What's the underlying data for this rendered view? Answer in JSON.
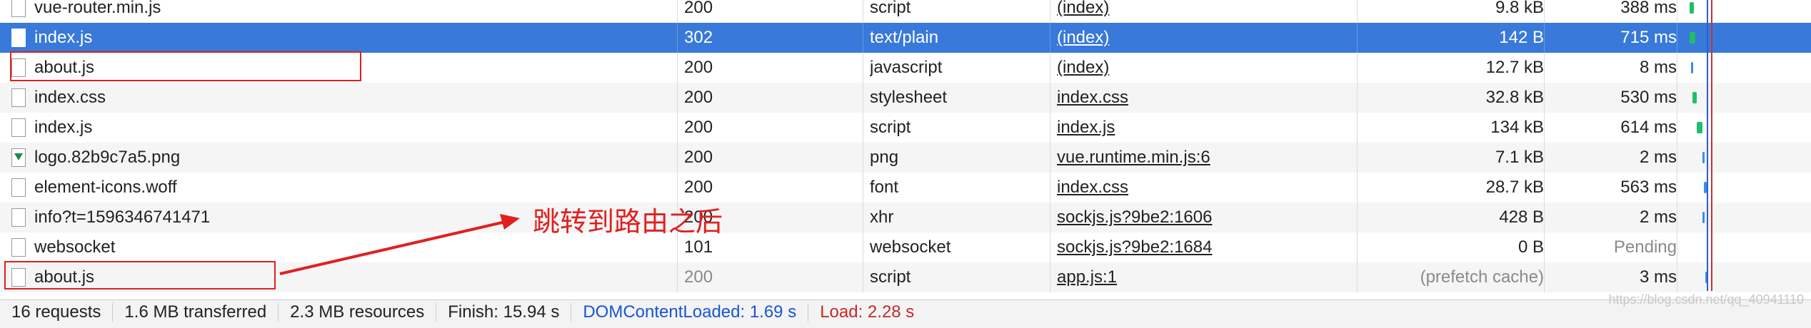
{
  "rows": [
    {
      "name": "vue-router.min.js",
      "status": "200",
      "type": "script",
      "initiator": "(index)",
      "size": "9.8 kB",
      "time": "388 ms",
      "icon": "file-icon",
      "size_dim": false,
      "status_dim": false
    },
    {
      "name": "index.js",
      "status": "302",
      "type": "text/plain",
      "initiator": "(index)",
      "size": "142 B",
      "time": "715 ms",
      "icon": "file-icon",
      "size_dim": false,
      "status_dim": false
    },
    {
      "name": "about.js",
      "status": "200",
      "type": "javascript",
      "initiator": "(index)",
      "size": "12.7 kB",
      "time": "8 ms",
      "icon": "file-icon",
      "size_dim": false,
      "status_dim": false
    },
    {
      "name": "index.css",
      "status": "200",
      "type": "stylesheet",
      "initiator": "index.css",
      "size": "32.8 kB",
      "time": "530 ms",
      "icon": "file-icon",
      "size_dim": false,
      "status_dim": false
    },
    {
      "name": "index.js",
      "status": "200",
      "type": "script",
      "initiator": "index.js",
      "size": "134 kB",
      "time": "614 ms",
      "icon": "file-icon",
      "size_dim": false,
      "status_dim": false
    },
    {
      "name": "logo.82b9c7a5.png",
      "status": "200",
      "type": "png",
      "initiator": "vue.runtime.min.js:6",
      "size": "7.1 kB",
      "time": "2 ms",
      "icon": "image-icon",
      "size_dim": false,
      "status_dim": false
    },
    {
      "name": "element-icons.woff",
      "status": "200",
      "type": "font",
      "initiator": "index.css",
      "size": "28.7 kB",
      "time": "563 ms",
      "icon": "file-icon",
      "size_dim": false,
      "status_dim": false
    },
    {
      "name": "info?t=1596346741471",
      "status": "200",
      "type": "xhr",
      "initiator": "sockjs.js?9be2:1606",
      "size": "428 B",
      "time": "2 ms",
      "icon": "file-icon",
      "size_dim": false,
      "status_dim": false
    },
    {
      "name": "websocket",
      "status": "101",
      "type": "websocket",
      "initiator": "sockjs.js?9be2:1684",
      "size": "0 B",
      "time": "Pending",
      "icon": "file-icon",
      "size_dim": false,
      "status_dim": false,
      "time_dim": true
    },
    {
      "name": "about.js",
      "status": "200",
      "type": "script",
      "initiator": "app.js:1",
      "size": "(prefetch cache)",
      "time": "3 ms",
      "icon": "file-icon",
      "size_dim": true,
      "status_dim": true
    }
  ],
  "selected_row_index": 1,
  "statusbar": {
    "requests": "16 requests",
    "transferred": "1.6 MB transferred",
    "resources": "2.3 MB resources",
    "finish": "Finish: 15.94 s",
    "dom_content_loaded": "DOMContentLoaded: 1.69 s",
    "load": "Load: 2.28 s"
  },
  "annotation": {
    "text": "跳转到路由之后",
    "color": "#e02020"
  },
  "watermark": "https://blog.csdn.net/qq_40941110",
  "colors": {
    "selected_row": "#3879d9",
    "alt_row": "#f5f5f5",
    "dom_line": "#2a5cd6",
    "load_line": "#c83232",
    "waterfall_green": "#1fbf6a",
    "waterfall_blue": "#3a8ee6"
  }
}
